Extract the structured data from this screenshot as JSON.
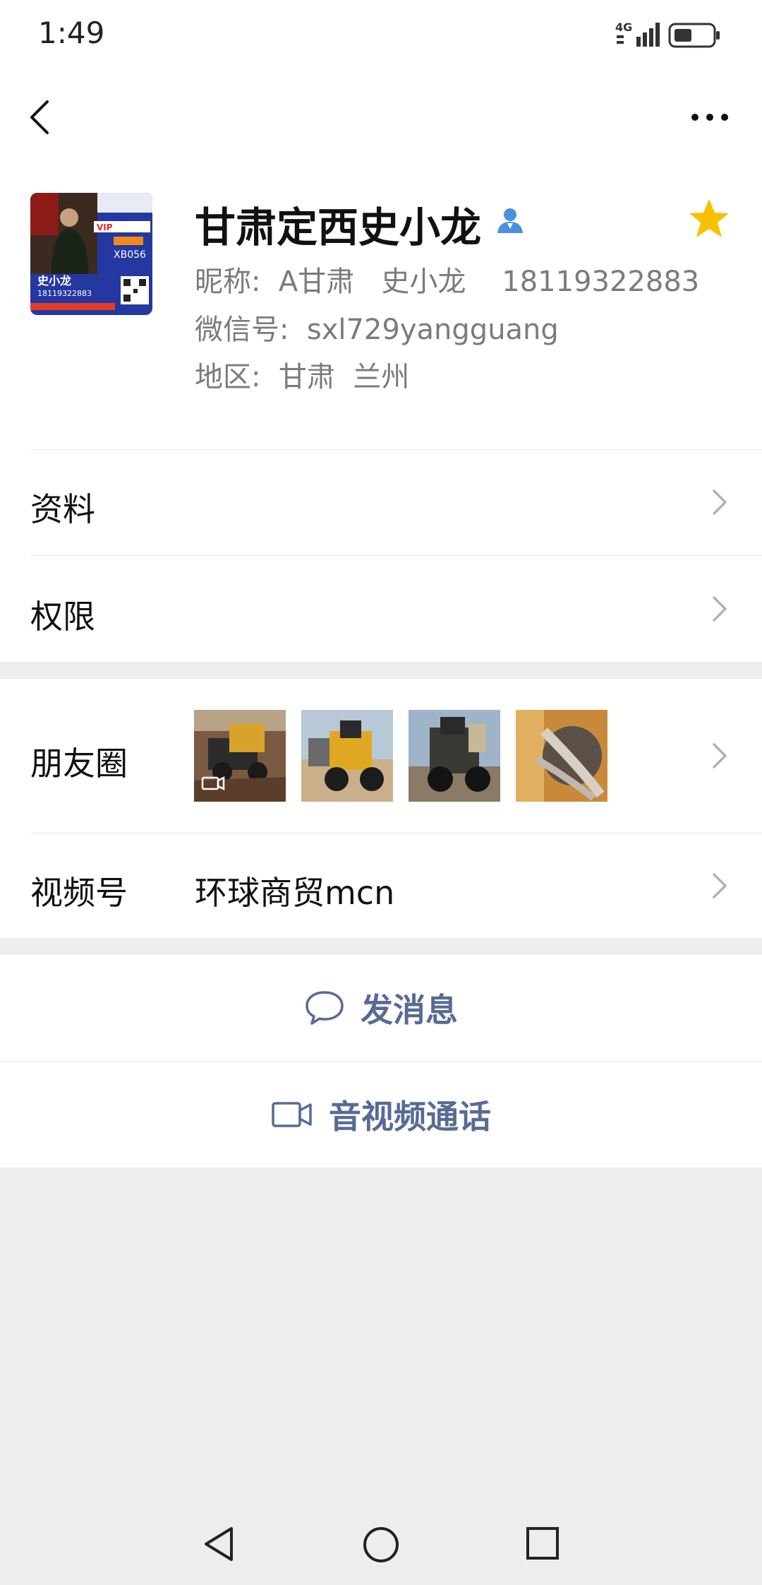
{
  "status_bar": {
    "time": "1:49",
    "network": "4G"
  },
  "profile": {
    "name": "甘肃定西史小龙",
    "nickname_line": "昵称:  A甘肃   史小龙    18119322883",
    "wechat_id_line": "微信号:  sxl729yangguang",
    "region_line": "地区:  甘肃  兰州",
    "avatar_card": {
      "name": "史小龙",
      "phone": "18119322883",
      "code": "XB056",
      "tag": "VIP"
    },
    "starred_color": "#f8c100"
  },
  "rows": {
    "profile_info": "资料",
    "permissions": "权限",
    "moments": "朋友圈",
    "channels": "视频号",
    "channels_value": "环球商贸mcn"
  },
  "actions": {
    "message": "发消息",
    "call": "音视频通话",
    "accent_color": "#576b95"
  },
  "icons": {
    "back": "back-arrow-icon",
    "more": "more-dots-icon",
    "verify": "person-verified-icon",
    "star": "star-icon",
    "chat": "chat-bubble-icon",
    "video": "video-camera-icon"
  }
}
